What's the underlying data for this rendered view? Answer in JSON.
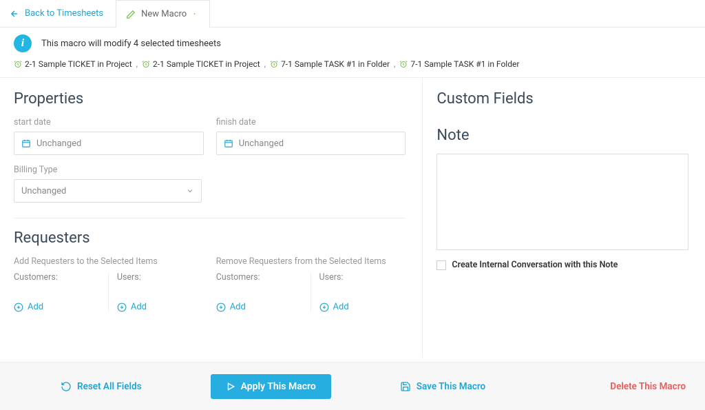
{
  "nav": {
    "back_label": "Back to Timesheets",
    "tab_label": "New Macro"
  },
  "info_text": "This macro will modify 4 selected timesheets",
  "timesheets": [
    "2-1 Sample TICKET in Project",
    "2-1 Sample TICKET in Project",
    "7-1 Sample TASK #1 in Folder",
    "7-1 Sample TASK #1 in Folder"
  ],
  "properties": {
    "heading": "Properties",
    "start_date_label": "start date",
    "start_date_value": "Unchanged",
    "finish_date_label": "finish date",
    "finish_date_value": "Unchanged",
    "billing_type_label": "Billing Type",
    "billing_type_value": "Unchanged"
  },
  "requesters": {
    "heading": "Requesters",
    "add_label": "Add Requesters to the Selected Items",
    "remove_label": "Remove Requesters from the Selected Items",
    "customers_label": "Customers:",
    "users_label": "Users:",
    "add_button": "Add"
  },
  "custom_fields": {
    "heading": "Custom Fields"
  },
  "note": {
    "heading": "Note",
    "checkbox_label": "Create Internal Conversation with this Note"
  },
  "footer": {
    "reset": "Reset All Fields",
    "apply": "Apply This Macro",
    "save": "Save This Macro",
    "delete": "Delete This Macro"
  },
  "colors": {
    "accent": "#26aee0",
    "green": "#6fbf3f",
    "danger": "#e85b5b"
  }
}
